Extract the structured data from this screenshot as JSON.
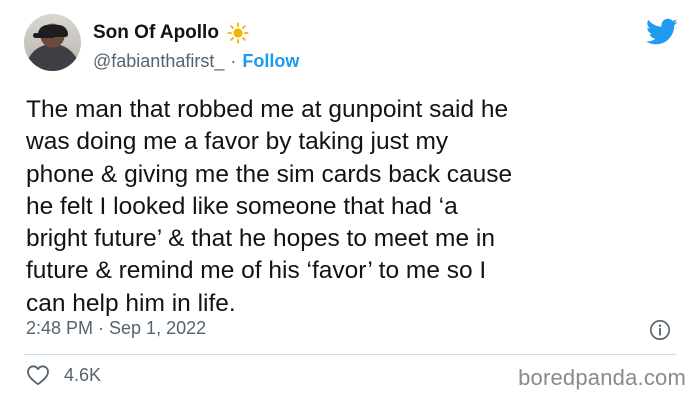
{
  "tweet": {
    "author": {
      "display_name": "Son Of Apollo",
      "name_emoji": "sun-icon",
      "handle": "@fabianthafirst_",
      "separator": "·",
      "follow_label": "Follow"
    },
    "brand_icon": "twitter-bird-icon",
    "text": "The man that robbed me at gunpoint said he\nwas doing me a favor by taking just my\nphone & giving me the sim cards back cause\nhe felt I looked like someone that had ‘a\nbright future’ & that he hopes to meet me in\nfuture & remind me of his ‘favor’ to me so I\ncan help him in life.",
    "timestamp": "2:48 PM · Sep 1, 2022",
    "info_icon": "info-icon",
    "likes": {
      "icon": "heart-icon",
      "count": "4.6K"
    }
  },
  "watermark": "boredpanda.com",
  "colors": {
    "accent": "#1d9bf0",
    "text_primary": "#0f1419",
    "text_secondary": "#536471",
    "sun": "#f4b400"
  }
}
